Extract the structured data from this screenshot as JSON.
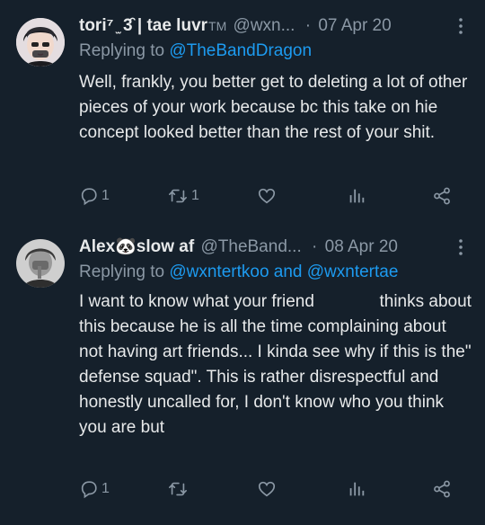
{
  "tweets": [
    {
      "name": "tori⁷ ̫ 3̑ | tae luvr",
      "name_suffix": "TM",
      "handle": "@wxn...",
      "separator": "·",
      "date": "07 Apr 20",
      "replying_prefix": "Replying to",
      "replying_to": "@TheBandDragon",
      "text": "Well, frankly, you better get to deleting a lot of other pieces of your work because bc this take on hie concept looked better than the rest of your shit.",
      "reply_count": "1",
      "retweet_count": "1",
      "like_count": ""
    },
    {
      "name": "Alex🐼slow af",
      "handle": "@TheBand...",
      "separator": "·",
      "date": "08 Apr 20",
      "replying_prefix": "Replying to",
      "replying_to": "@wxntertkoo and @wxntertae",
      "text_part1": "I want to know what your friend",
      "text_part2": "thinks about this because he is all the time complaining about not having art friends... I kinda see why if this is the\" defense squad\". This is rather disrespectful and honestly uncalled for, I don't know who you think you are but",
      "reply_count": "1",
      "retweet_count": "",
      "like_count": ""
    }
  ],
  "colors": {
    "background": "#15202b",
    "text": "#e7e9ea",
    "muted": "#8b98a5",
    "link": "#1d9bf0"
  },
  "icons": [
    "reply-icon",
    "retweet-icon",
    "like-icon",
    "analytics-icon",
    "share-icon",
    "more-icon"
  ]
}
